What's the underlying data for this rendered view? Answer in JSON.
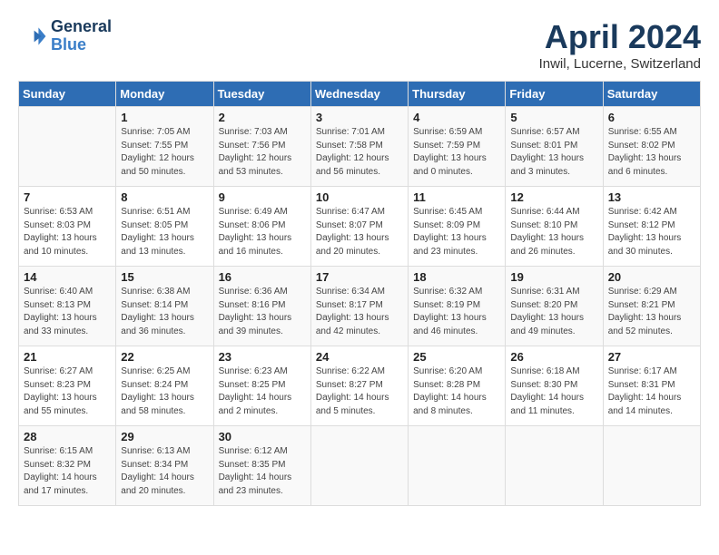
{
  "header": {
    "logo_line1": "General",
    "logo_line2": "Blue",
    "month_title": "April 2024",
    "location": "Inwil, Lucerne, Switzerland"
  },
  "weekdays": [
    "Sunday",
    "Monday",
    "Tuesday",
    "Wednesday",
    "Thursday",
    "Friday",
    "Saturday"
  ],
  "weeks": [
    [
      {
        "day": "",
        "info": ""
      },
      {
        "day": "1",
        "info": "Sunrise: 7:05 AM\nSunset: 7:55 PM\nDaylight: 12 hours\nand 50 minutes."
      },
      {
        "day": "2",
        "info": "Sunrise: 7:03 AM\nSunset: 7:56 PM\nDaylight: 12 hours\nand 53 minutes."
      },
      {
        "day": "3",
        "info": "Sunrise: 7:01 AM\nSunset: 7:58 PM\nDaylight: 12 hours\nand 56 minutes."
      },
      {
        "day": "4",
        "info": "Sunrise: 6:59 AM\nSunset: 7:59 PM\nDaylight: 13 hours\nand 0 minutes."
      },
      {
        "day": "5",
        "info": "Sunrise: 6:57 AM\nSunset: 8:01 PM\nDaylight: 13 hours\nand 3 minutes."
      },
      {
        "day": "6",
        "info": "Sunrise: 6:55 AM\nSunset: 8:02 PM\nDaylight: 13 hours\nand 6 minutes."
      }
    ],
    [
      {
        "day": "7",
        "info": "Sunrise: 6:53 AM\nSunset: 8:03 PM\nDaylight: 13 hours\nand 10 minutes."
      },
      {
        "day": "8",
        "info": "Sunrise: 6:51 AM\nSunset: 8:05 PM\nDaylight: 13 hours\nand 13 minutes."
      },
      {
        "day": "9",
        "info": "Sunrise: 6:49 AM\nSunset: 8:06 PM\nDaylight: 13 hours\nand 16 minutes."
      },
      {
        "day": "10",
        "info": "Sunrise: 6:47 AM\nSunset: 8:07 PM\nDaylight: 13 hours\nand 20 minutes."
      },
      {
        "day": "11",
        "info": "Sunrise: 6:45 AM\nSunset: 8:09 PM\nDaylight: 13 hours\nand 23 minutes."
      },
      {
        "day": "12",
        "info": "Sunrise: 6:44 AM\nSunset: 8:10 PM\nDaylight: 13 hours\nand 26 minutes."
      },
      {
        "day": "13",
        "info": "Sunrise: 6:42 AM\nSunset: 8:12 PM\nDaylight: 13 hours\nand 30 minutes."
      }
    ],
    [
      {
        "day": "14",
        "info": "Sunrise: 6:40 AM\nSunset: 8:13 PM\nDaylight: 13 hours\nand 33 minutes."
      },
      {
        "day": "15",
        "info": "Sunrise: 6:38 AM\nSunset: 8:14 PM\nDaylight: 13 hours\nand 36 minutes."
      },
      {
        "day": "16",
        "info": "Sunrise: 6:36 AM\nSunset: 8:16 PM\nDaylight: 13 hours\nand 39 minutes."
      },
      {
        "day": "17",
        "info": "Sunrise: 6:34 AM\nSunset: 8:17 PM\nDaylight: 13 hours\nand 42 minutes."
      },
      {
        "day": "18",
        "info": "Sunrise: 6:32 AM\nSunset: 8:19 PM\nDaylight: 13 hours\nand 46 minutes."
      },
      {
        "day": "19",
        "info": "Sunrise: 6:31 AM\nSunset: 8:20 PM\nDaylight: 13 hours\nand 49 minutes."
      },
      {
        "day": "20",
        "info": "Sunrise: 6:29 AM\nSunset: 8:21 PM\nDaylight: 13 hours\nand 52 minutes."
      }
    ],
    [
      {
        "day": "21",
        "info": "Sunrise: 6:27 AM\nSunset: 8:23 PM\nDaylight: 13 hours\nand 55 minutes."
      },
      {
        "day": "22",
        "info": "Sunrise: 6:25 AM\nSunset: 8:24 PM\nDaylight: 13 hours\nand 58 minutes."
      },
      {
        "day": "23",
        "info": "Sunrise: 6:23 AM\nSunset: 8:25 PM\nDaylight: 14 hours\nand 2 minutes."
      },
      {
        "day": "24",
        "info": "Sunrise: 6:22 AM\nSunset: 8:27 PM\nDaylight: 14 hours\nand 5 minutes."
      },
      {
        "day": "25",
        "info": "Sunrise: 6:20 AM\nSunset: 8:28 PM\nDaylight: 14 hours\nand 8 minutes."
      },
      {
        "day": "26",
        "info": "Sunrise: 6:18 AM\nSunset: 8:30 PM\nDaylight: 14 hours\nand 11 minutes."
      },
      {
        "day": "27",
        "info": "Sunrise: 6:17 AM\nSunset: 8:31 PM\nDaylight: 14 hours\nand 14 minutes."
      }
    ],
    [
      {
        "day": "28",
        "info": "Sunrise: 6:15 AM\nSunset: 8:32 PM\nDaylight: 14 hours\nand 17 minutes."
      },
      {
        "day": "29",
        "info": "Sunrise: 6:13 AM\nSunset: 8:34 PM\nDaylight: 14 hours\nand 20 minutes."
      },
      {
        "day": "30",
        "info": "Sunrise: 6:12 AM\nSunset: 8:35 PM\nDaylight: 14 hours\nand 23 minutes."
      },
      {
        "day": "",
        "info": ""
      },
      {
        "day": "",
        "info": ""
      },
      {
        "day": "",
        "info": ""
      },
      {
        "day": "",
        "info": ""
      }
    ]
  ]
}
